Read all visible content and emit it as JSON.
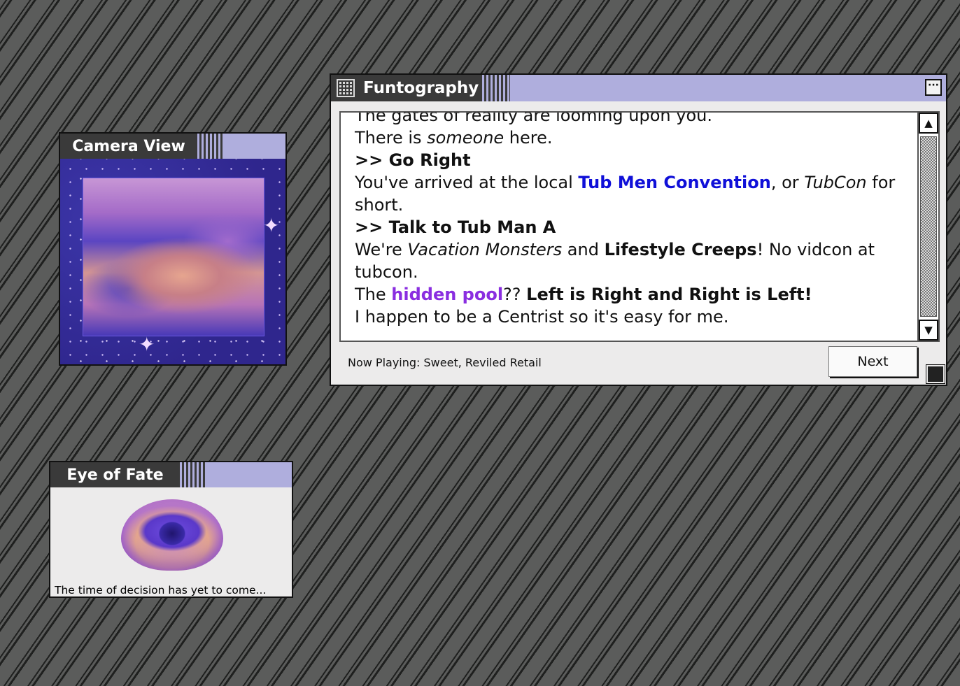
{
  "camera_window": {
    "title": "Camera View"
  },
  "eye_window": {
    "title": "Eye of Fate",
    "caption": "The time of decision has yet to come..."
  },
  "funtography_window": {
    "title": "Funtography",
    "menu_icon": "ellipsis-icon",
    "story": {
      "line0": "The gates of reality are looming upon you.",
      "line1_pre": "There is ",
      "line1_em": "someone",
      "line1_post": " here.",
      "choice1": ">> Go Right",
      "line2_pre": "You've arrived at the local ",
      "line2_link": "Tub Men Convention",
      "line2_mid": ", or ",
      "line2_em": "TubCon",
      "line2_post": " for short.",
      "choice2": ">> Talk to Tub Man A",
      "line3_pre": "We're ",
      "line3_em": "Vacation Monsters",
      "line3_mid": " and ",
      "line3_bold": "Lifestyle Creeps",
      "line3_post": "! No vidcon at tubcon.",
      "line4_pre": "The ",
      "line4_link": "hidden pool",
      "line4_mid": "?? ",
      "line4_bold": "Left is Right and Right is Left!",
      "line5": "I happen to be a Centrist so it's easy for me."
    },
    "now_playing": "Now Playing: Sweet, Reviled Retail",
    "next_label": "Next",
    "scroll_up_icon": "scroll-up-arrow-icon",
    "scroll_down_icon": "scroll-down-arrow-icon"
  }
}
